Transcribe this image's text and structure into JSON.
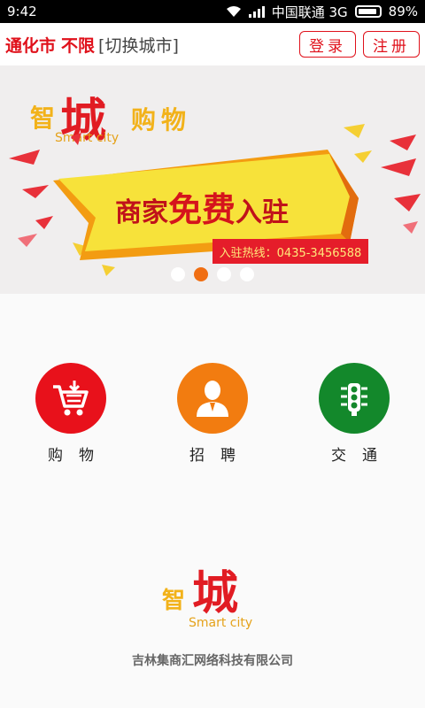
{
  "status": {
    "time": "9:42",
    "carrier": "中国联通 3G",
    "battery": "89%"
  },
  "header": {
    "city": "通化市",
    "limit": "不限",
    "switch_city": "[切换城市]",
    "login": "登录",
    "register": "注册"
  },
  "banner": {
    "logo_zhi": "智",
    "logo_cheng": "城",
    "logo_gouwu": "购物",
    "logo_smart": "Smart city",
    "headline_a": "商家",
    "headline_b": "免费",
    "headline_c": "入驻",
    "hotline": "入驻热线：0435-3456588",
    "slide_count": 4,
    "active_slide": 2
  },
  "menu": [
    {
      "label": "购物",
      "icon": "shopping-cart-icon",
      "color": "#e8111b"
    },
    {
      "label": "招聘",
      "icon": "person-icon",
      "color": "#f27c10"
    },
    {
      "label": "交通",
      "icon": "traffic-light-icon",
      "color": "#13882b"
    }
  ],
  "footer": {
    "logo_zhi": "智",
    "logo_cheng": "城",
    "logo_smart": "Smart city",
    "company": "吉林集商汇网络科技有限公司"
  }
}
